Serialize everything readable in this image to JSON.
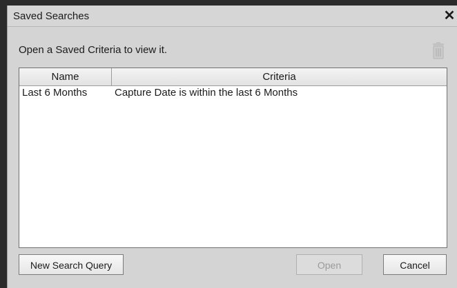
{
  "dialog": {
    "title": "Saved Searches",
    "close_label": "✕",
    "instruction": "Open a Saved Criteria to view it."
  },
  "table": {
    "columns": [
      "Name",
      "Criteria"
    ],
    "rows": [
      {
        "name": "Last 6 Months",
        "criteria": "Capture Date is within the last 6 Months"
      }
    ]
  },
  "buttons": {
    "new_search": "New Search Query",
    "open": "Open",
    "cancel": "Cancel"
  },
  "state": {
    "open_enabled": false
  },
  "icons": {
    "delete": "trash-icon"
  }
}
